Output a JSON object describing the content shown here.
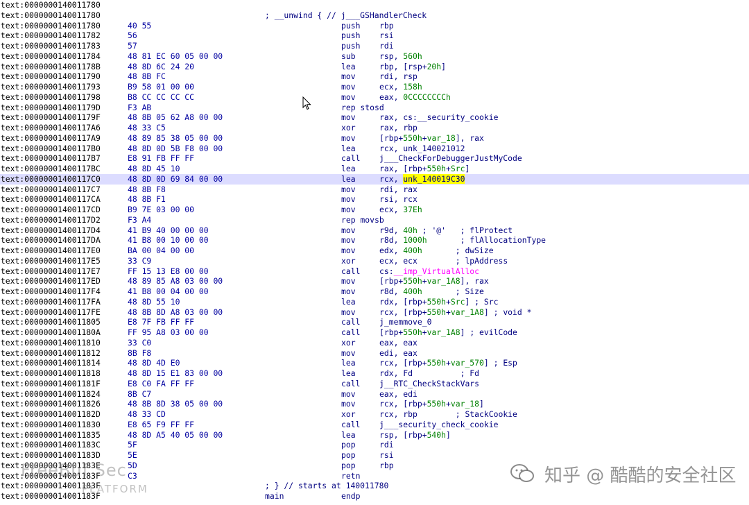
{
  "header_line": "; __unwind { // j___GSHandlerCheck",
  "footer_line": "; } // starts at 140011780",
  "function_end": {
    "label": "main",
    "mnemonic": "endp"
  },
  "lines": [
    {
      "addr": ".text:0000000140011780",
      "bytes": "",
      "mnemonic": "",
      "ops": []
    },
    {
      "addr": ".text:0000000140011780",
      "bytes": "",
      "mnemonic": "",
      "ops": [],
      "special": "header"
    },
    {
      "addr": ".text:0000000140011780",
      "bytes": "40 55",
      "mnemonic": "push",
      "ops": [
        {
          "t": "rbp",
          "c": "reg"
        }
      ]
    },
    {
      "addr": ".text:0000000140011782",
      "bytes": "56",
      "mnemonic": "push",
      "ops": [
        {
          "t": "rsi",
          "c": "reg"
        }
      ]
    },
    {
      "addr": ".text:0000000140011783",
      "bytes": "57",
      "mnemonic": "push",
      "ops": [
        {
          "t": "rdi",
          "c": "reg"
        }
      ]
    },
    {
      "addr": ".text:0000000140011784",
      "bytes": "48 81 EC 60 05 00 00",
      "mnemonic": "sub",
      "ops": [
        {
          "t": "rsp, ",
          "c": "reg"
        },
        {
          "t": "560h",
          "c": "num"
        }
      ]
    },
    {
      "addr": ".text:000000014001178B",
      "bytes": "48 8D 6C 24 20",
      "mnemonic": "lea",
      "ops": [
        {
          "t": "rbp, [rsp+",
          "c": "reg"
        },
        {
          "t": "20h",
          "c": "num"
        },
        {
          "t": "]",
          "c": "reg"
        }
      ]
    },
    {
      "addr": ".text:0000000140011790",
      "bytes": "48 8B FC",
      "mnemonic": "mov",
      "ops": [
        {
          "t": "rdi, rsp",
          "c": "reg"
        }
      ]
    },
    {
      "addr": ".text:0000000140011793",
      "bytes": "B9 58 01 00 00",
      "mnemonic": "mov",
      "ops": [
        {
          "t": "ecx, ",
          "c": "reg"
        },
        {
          "t": "158h",
          "c": "num"
        }
      ]
    },
    {
      "addr": ".text:0000000140011798",
      "bytes": "B8 CC CC CC CC",
      "mnemonic": "mov",
      "ops": [
        {
          "t": "eax, ",
          "c": "reg"
        },
        {
          "t": "0CCCCCCCCh",
          "c": "num"
        }
      ]
    },
    {
      "addr": ".text:000000014001179D",
      "bytes": "F3 AB",
      "mnemonic": "rep stosd",
      "ops": []
    },
    {
      "addr": ".text:000000014001179F",
      "bytes": "48 8B 05 62 A8 00 00",
      "mnemonic": "mov",
      "ops": [
        {
          "t": "rax, cs:",
          "c": "reg"
        },
        {
          "t": "__security_cookie",
          "c": "name"
        }
      ]
    },
    {
      "addr": ".text:00000001400117A6",
      "bytes": "48 33 C5",
      "mnemonic": "xor",
      "ops": [
        {
          "t": "rax, rbp",
          "c": "reg"
        }
      ]
    },
    {
      "addr": ".text:00000001400117A9",
      "bytes": "48 89 85 38 05 00 00",
      "mnemonic": "mov",
      "ops": [
        {
          "t": "[rbp+",
          "c": "reg"
        },
        {
          "t": "550h",
          "c": "num"
        },
        {
          "t": "+",
          "c": "reg"
        },
        {
          "t": "var_18",
          "c": "var"
        },
        {
          "t": "], rax",
          "c": "reg"
        }
      ]
    },
    {
      "addr": ".text:00000001400117B0",
      "bytes": "48 8D 0D 5B F8 00 00",
      "mnemonic": "lea",
      "ops": [
        {
          "t": "rcx, ",
          "c": "reg"
        },
        {
          "t": "unk_140021012",
          "c": "name"
        }
      ]
    },
    {
      "addr": ".text:00000001400117B7",
      "bytes": "E8 91 FB FF FF",
      "mnemonic": "call",
      "ops": [
        {
          "t": "j___CheckForDebuggerJustMyCode",
          "c": "name"
        }
      ]
    },
    {
      "addr": ".text:00000001400117BC",
      "bytes": "48 8D 45 10",
      "mnemonic": "lea",
      "ops": [
        {
          "t": "rax, [rbp+",
          "c": "reg"
        },
        {
          "t": "550h",
          "c": "num"
        },
        {
          "t": "+",
          "c": "reg"
        },
        {
          "t": "Src",
          "c": "var"
        },
        {
          "t": "]",
          "c": "reg"
        }
      ]
    },
    {
      "addr": ".text:00000001400117C0",
      "bytes": "48 8D 0D 69 84 00 00",
      "mnemonic": "lea",
      "ops": [
        {
          "t": "rcx, ",
          "c": "reg"
        },
        {
          "t": "unk_140019C30",
          "c": "hl"
        }
      ],
      "current": true
    },
    {
      "addr": ".text:00000001400117C7",
      "bytes": "48 8B F8",
      "mnemonic": "mov",
      "ops": [
        {
          "t": "rdi, rax",
          "c": "reg"
        }
      ]
    },
    {
      "addr": ".text:00000001400117CA",
      "bytes": "48 8B F1",
      "mnemonic": "mov",
      "ops": [
        {
          "t": "rsi, rcx",
          "c": "reg"
        }
      ]
    },
    {
      "addr": ".text:00000001400117CD",
      "bytes": "B9 7E 03 00 00",
      "mnemonic": "mov",
      "ops": [
        {
          "t": "ecx, ",
          "c": "reg"
        },
        {
          "t": "37Eh",
          "c": "num"
        }
      ]
    },
    {
      "addr": ".text:00000001400117D2",
      "bytes": "F3 A4",
      "mnemonic": "rep movsb",
      "ops": []
    },
    {
      "addr": ".text:00000001400117D4",
      "bytes": "41 B9 40 00 00 00",
      "mnemonic": "mov",
      "ops": [
        {
          "t": "r9d, ",
          "c": "reg"
        },
        {
          "t": "40h",
          "c": "num"
        },
        {
          "t": " ; '@'   ; flProtect",
          "c": "cmt"
        }
      ]
    },
    {
      "addr": ".text:00000001400117DA",
      "bytes": "41 B8 00 10 00 00",
      "mnemonic": "mov",
      "ops": [
        {
          "t": "r8d, ",
          "c": "reg"
        },
        {
          "t": "1000h",
          "c": "num"
        },
        {
          "t": "       ; flAllocationType",
          "c": "cmt"
        }
      ]
    },
    {
      "addr": ".text:00000001400117E0",
      "bytes": "BA 00 04 00 00",
      "mnemonic": "mov",
      "ops": [
        {
          "t": "edx, ",
          "c": "reg"
        },
        {
          "t": "400h",
          "c": "num"
        },
        {
          "t": "       ; dwSize",
          "c": "cmt"
        }
      ]
    },
    {
      "addr": ".text:00000001400117E5",
      "bytes": "33 C9",
      "mnemonic": "xor",
      "ops": [
        {
          "t": "ecx, ecx",
          "c": "reg"
        },
        {
          "t": "        ; lpAddress",
          "c": "cmt"
        }
      ]
    },
    {
      "addr": ".text:00000001400117E7",
      "bytes": "FF 15 13 E8 00 00",
      "mnemonic": "call",
      "ops": [
        {
          "t": "cs:",
          "c": "reg"
        },
        {
          "t": "__imp_VirtualAlloc",
          "c": "imp"
        }
      ]
    },
    {
      "addr": ".text:00000001400117ED",
      "bytes": "48 89 85 A8 03 00 00",
      "mnemonic": "mov",
      "ops": [
        {
          "t": "[rbp+",
          "c": "reg"
        },
        {
          "t": "550h",
          "c": "num"
        },
        {
          "t": "+",
          "c": "reg"
        },
        {
          "t": "var_1A8",
          "c": "var"
        },
        {
          "t": "], rax",
          "c": "reg"
        }
      ]
    },
    {
      "addr": ".text:00000001400117F4",
      "bytes": "41 B8 00 04 00 00",
      "mnemonic": "mov",
      "ops": [
        {
          "t": "r8d, ",
          "c": "reg"
        },
        {
          "t": "400h",
          "c": "num"
        },
        {
          "t": "       ; Size",
          "c": "cmt"
        }
      ]
    },
    {
      "addr": ".text:00000001400117FA",
      "bytes": "48 8D 55 10",
      "mnemonic": "lea",
      "ops": [
        {
          "t": "rdx, [rbp+",
          "c": "reg"
        },
        {
          "t": "550h",
          "c": "num"
        },
        {
          "t": "+",
          "c": "reg"
        },
        {
          "t": "Src",
          "c": "var"
        },
        {
          "t": "] ; Src",
          "c": "reg"
        }
      ]
    },
    {
      "addr": ".text:00000001400117FE",
      "bytes": "48 8B 8D A8 03 00 00",
      "mnemonic": "mov",
      "ops": [
        {
          "t": "rcx, [rbp+",
          "c": "reg"
        },
        {
          "t": "550h",
          "c": "num"
        },
        {
          "t": "+",
          "c": "reg"
        },
        {
          "t": "var_1A8",
          "c": "var"
        },
        {
          "t": "] ; void *",
          "c": "reg"
        }
      ]
    },
    {
      "addr": ".text:0000000140011805",
      "bytes": "E8 7F FB FF FF",
      "mnemonic": "call",
      "ops": [
        {
          "t": "j_memmove_0",
          "c": "name"
        }
      ]
    },
    {
      "addr": ".text:000000014001180A",
      "bytes": "FF 95 A8 03 00 00",
      "mnemonic": "call",
      "ops": [
        {
          "t": "[rbp+",
          "c": "reg"
        },
        {
          "t": "550h",
          "c": "num"
        },
        {
          "t": "+",
          "c": "reg"
        },
        {
          "t": "var_1A8",
          "c": "var"
        },
        {
          "t": "] ; evilCode",
          "c": "reg"
        }
      ]
    },
    {
      "addr": ".text:0000000140011810",
      "bytes": "33 C0",
      "mnemonic": "xor",
      "ops": [
        {
          "t": "eax, eax",
          "c": "reg"
        }
      ]
    },
    {
      "addr": ".text:0000000140011812",
      "bytes": "8B F8",
      "mnemonic": "mov",
      "ops": [
        {
          "t": "edi, eax",
          "c": "reg"
        }
      ]
    },
    {
      "addr": ".text:0000000140011814",
      "bytes": "48 8D 4D E0",
      "mnemonic": "lea",
      "ops": [
        {
          "t": "rcx, [rbp+",
          "c": "reg"
        },
        {
          "t": "550h",
          "c": "num"
        },
        {
          "t": "+",
          "c": "reg"
        },
        {
          "t": "var_570",
          "c": "var"
        },
        {
          "t": "] ; Esp",
          "c": "reg"
        }
      ]
    },
    {
      "addr": ".text:0000000140011818",
      "bytes": "48 8D 15 E1 83 00 00",
      "mnemonic": "lea",
      "ops": [
        {
          "t": "rdx, ",
          "c": "reg"
        },
        {
          "t": "Fd",
          "c": "name"
        },
        {
          "t": "          ; Fd",
          "c": "cmt"
        }
      ]
    },
    {
      "addr": ".text:000000014001181F",
      "bytes": "E8 C0 FA FF FF",
      "mnemonic": "call",
      "ops": [
        {
          "t": "j__RTC_CheckStackVars",
          "c": "name"
        }
      ]
    },
    {
      "addr": ".text:0000000140011824",
      "bytes": "8B C7",
      "mnemonic": "mov",
      "ops": [
        {
          "t": "eax, edi",
          "c": "reg"
        }
      ]
    },
    {
      "addr": ".text:0000000140011826",
      "bytes": "48 8B 8D 38 05 00 00",
      "mnemonic": "mov",
      "ops": [
        {
          "t": "rcx, [rbp+",
          "c": "reg"
        },
        {
          "t": "550h",
          "c": "num"
        },
        {
          "t": "+",
          "c": "reg"
        },
        {
          "t": "var_18",
          "c": "var"
        },
        {
          "t": "]",
          "c": "reg"
        }
      ]
    },
    {
      "addr": ".text:000000014001182D",
      "bytes": "48 33 CD",
      "mnemonic": "xor",
      "ops": [
        {
          "t": "rcx, rbp",
          "c": "reg"
        },
        {
          "t": "        ; StackCookie",
          "c": "cmt"
        }
      ]
    },
    {
      "addr": ".text:0000000140011830",
      "bytes": "E8 65 F9 FF FF",
      "mnemonic": "call",
      "ops": [
        {
          "t": "j___security_check_cookie",
          "c": "name"
        }
      ]
    },
    {
      "addr": ".text:0000000140011835",
      "bytes": "48 8D A5 40 05 00 00",
      "mnemonic": "lea",
      "ops": [
        {
          "t": "rsp, [rbp+",
          "c": "reg"
        },
        {
          "t": "540h",
          "c": "num"
        },
        {
          "t": "]",
          "c": "reg"
        }
      ]
    },
    {
      "addr": ".text:000000014001183C",
      "bytes": "5F",
      "mnemonic": "pop",
      "ops": [
        {
          "t": "rdi",
          "c": "reg"
        }
      ]
    },
    {
      "addr": ".text:000000014001183D",
      "bytes": "5E",
      "mnemonic": "pop",
      "ops": [
        {
          "t": "rsi",
          "c": "reg"
        }
      ]
    },
    {
      "addr": ".text:000000014001183E",
      "bytes": "5D",
      "mnemonic": "pop",
      "ops": [
        {
          "t": "rbp",
          "c": "reg"
        }
      ]
    },
    {
      "addr": ".text:000000014001183F",
      "bytes": "C3",
      "mnemonic": "retn",
      "ops": []
    },
    {
      "addr": ".text:000000014001183F",
      "bytes": "",
      "mnemonic": "",
      "ops": [],
      "special": "footer"
    },
    {
      "addr": ".text:000000014001183F",
      "bytes": "",
      "mnemonic": "",
      "ops": [],
      "special": "end"
    }
  ],
  "colors": {
    "text": "#000000",
    "bytes": "#0000a0",
    "mnemonic": "#000080",
    "number": "#008000",
    "import": "#ff00ff",
    "highlight": "#ffff00",
    "current_line": "#dcdcff"
  },
  "watermarks": {
    "left": "FreeBuf Sec",
    "left_sub": "PLATFORM",
    "right": "知乎 @ 酷酷的安全社区"
  }
}
